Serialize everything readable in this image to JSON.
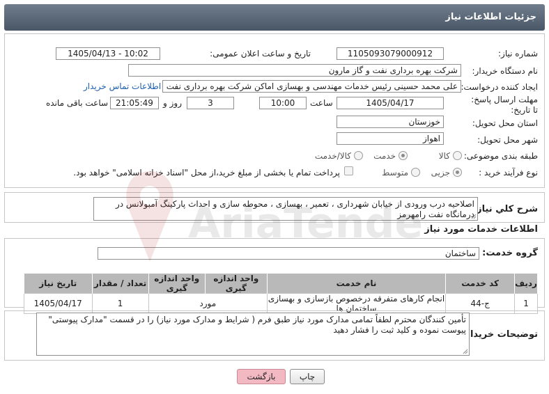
{
  "header": {
    "title": "جزئیات اطلاعات نیاز"
  },
  "form": {
    "need_number_label": "شماره نیاز:",
    "need_number": "1105093079000912",
    "announce_label": "تاریخ و ساعت اعلان عمومی:",
    "announce_value": "1405/04/13 - 10:02",
    "buyer_org_label": "نام دستگاه خریدار:",
    "buyer_org": "شرکت بهره برداری نفت و گاز مارون",
    "creator_label": "ایجاد کننده درخواست:",
    "creator": "علی محمد حسینی رئیس خدمات مهندسی و بهسازی اماکن شرکت بهره برداری نفت و گاز مارون",
    "contact_link": "اطلاعات تماس خریدار",
    "deadline_label": "مهلت ارسال پاسخ: تا تاریخ:",
    "deadline_date": "1405/04/17",
    "time_label": "ساعت",
    "deadline_time": "10:00",
    "days_value": "3",
    "days_label": "روز و",
    "remaining_time": "21:05:49",
    "remaining_label": "ساعت باقی مانده",
    "province_label": "استان محل تحویل:",
    "province": "خوزستان",
    "city_label": "شهر محل تحویل:",
    "city": "اهواز",
    "category_label": "طبقه بندی موضوعی:",
    "category_options": [
      "کالا",
      "خدمت",
      "کالا/خدمت"
    ],
    "category_selected": "خدمت",
    "purchase_type_label": "نوع فرآیند خرید :",
    "purchase_options": [
      "جزیی",
      "متوسط"
    ],
    "purchase_selected": "جزیی",
    "payment_note": "پرداخت تمام یا بخشی از مبلغ خرید،از محل \"اسناد خزانه اسلامی\" خواهد بود."
  },
  "summary": {
    "label": "شرح کلي نياز:",
    "text": "اصلاحیه درب ورودی از خیابان شهرداری ، تعمیر ، بهسازی ، محوطه سازی و احداث پارکینگ آمبولانس در درمانگاه نفت رامهرمز"
  },
  "services": {
    "section_title": "اطلاعات خدمات مورد نیاز",
    "group_label": "گروه خدمت:",
    "group_value": "ساختمان",
    "columns": [
      "ردیف",
      "کد خدمت",
      "نام خدمت",
      "واحد اندازه گیری",
      "تعداد / مقدار",
      "تاریخ نیاز"
    ],
    "rows": [
      {
        "row": "1",
        "code": "ج-44",
        "name": "انجام کارهای متفرقه درخصوص بازسازی و بهسازی ساختمان ها",
        "unit": "مورد",
        "qty": "1",
        "date": "1405/04/17"
      }
    ]
  },
  "notes": {
    "label": "توضیحات خریدار:",
    "text": "تأمین کنندگان محترم لطفاً تمامی مدارک مورد نیاز طبق فرم ( شرایط و مدارک مورد نیاز) را در قسمت \"مدارک پیوستی\" پیوست نموده و کلید ثبت را فشار دهید"
  },
  "buttons": {
    "print": "چاپ",
    "back": "بازگشت"
  },
  "watermark": {
    "text": "AriaTender.net"
  },
  "colors": {
    "header": "#5c6a79",
    "link": "#1d5fb0",
    "back_button": "#f3b9c3",
    "table_header": "#b9b9b9"
  }
}
